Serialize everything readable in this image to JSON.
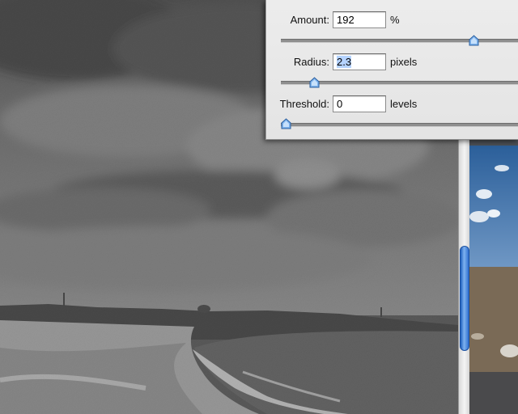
{
  "filter_dialog": {
    "amount": {
      "label": "Amount:",
      "value": "192",
      "unit": "%",
      "slider_fraction": 0.79
    },
    "radius": {
      "label": "Radius:",
      "value": "2.3",
      "unit": "pixels",
      "slider_fraction": 0.12
    },
    "threshold": {
      "label": "Threshold:",
      "value": "0",
      "unit": "levels",
      "slider_fraction": 0.0
    }
  },
  "scrollbar": {
    "position_fraction": 0.63
  },
  "colors": {
    "accent": "#3a7be0",
    "selection": "#b5d3ff",
    "dialog_bg": "#e8e8e8"
  }
}
